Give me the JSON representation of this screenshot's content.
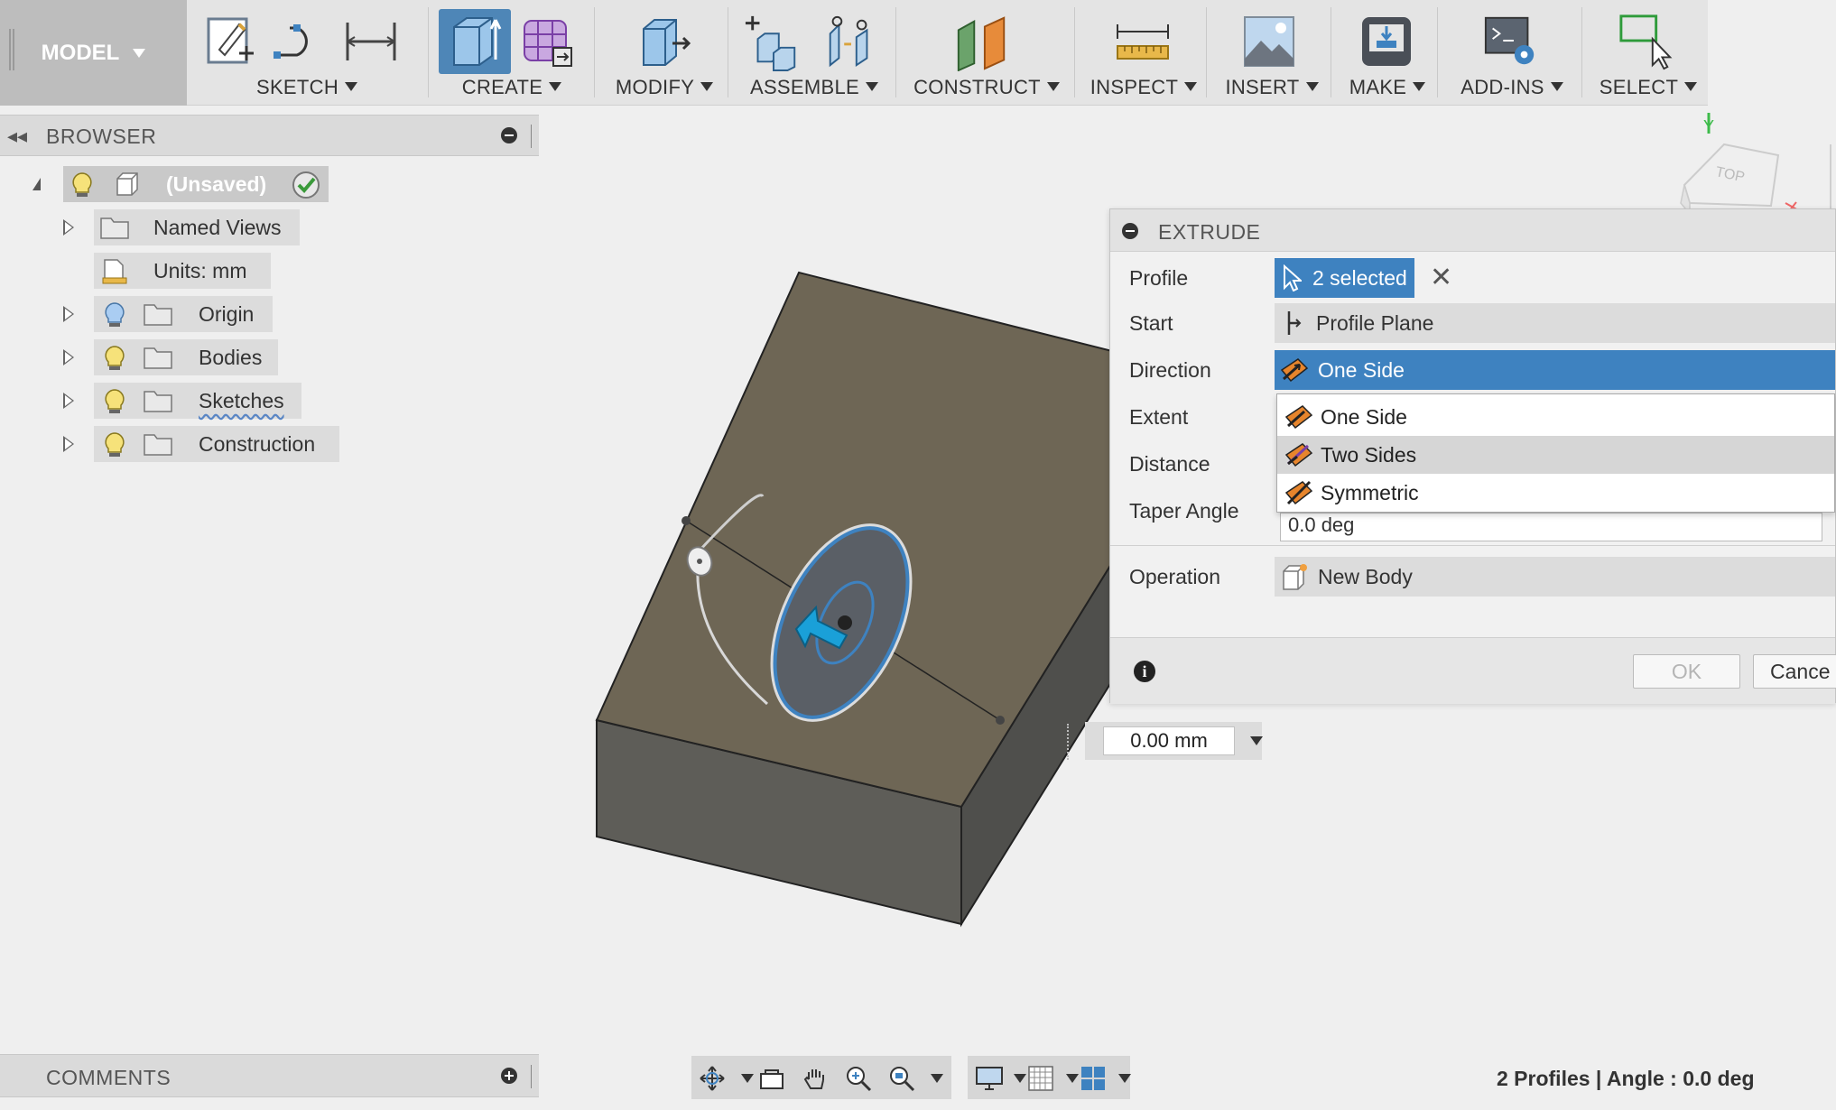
{
  "toolbar": {
    "workspace": "MODEL",
    "groups": [
      {
        "label": "SKETCH"
      },
      {
        "label": "CREATE"
      },
      {
        "label": "MODIFY"
      },
      {
        "label": "ASSEMBLE"
      },
      {
        "label": "CONSTRUCT"
      },
      {
        "label": "INSPECT"
      },
      {
        "label": "INSERT"
      },
      {
        "label": "MAKE"
      },
      {
        "label": "ADD-INS"
      },
      {
        "label": "SELECT"
      }
    ]
  },
  "browser": {
    "title": "BROWSER",
    "root": {
      "label": "(Unsaved)"
    },
    "items": [
      {
        "label": "Named Views"
      },
      {
        "label": "Units: mm"
      },
      {
        "label": "Origin"
      },
      {
        "label": "Bodies"
      },
      {
        "label": "Sketches"
      },
      {
        "label": "Construction"
      }
    ]
  },
  "comments": {
    "title": "COMMENTS"
  },
  "viewcube": {
    "face_label": "TOP",
    "axis_y": "Y"
  },
  "extrude": {
    "title": "EXTRUDE",
    "profile": {
      "label": "Profile",
      "value": "2 selected"
    },
    "start": {
      "label": "Start",
      "value": "Profile Plane"
    },
    "direction": {
      "label": "Direction",
      "value": "One Side",
      "options": [
        "One Side",
        "Two Sides",
        "Symmetric"
      ]
    },
    "extent": {
      "label": "Extent"
    },
    "distance": {
      "label": "Distance"
    },
    "taper_angle": {
      "label": "Taper Angle",
      "value": "0.0 deg"
    },
    "operation": {
      "label": "Operation",
      "value": "New Body"
    },
    "ok_label": "OK",
    "cancel_label": "Cance"
  },
  "distance_input": {
    "value": "0.00 mm"
  },
  "status": {
    "text": "2 Profiles | Angle : 0.0 deg"
  },
  "colors": {
    "accent": "#3e82c0",
    "body_top": "#6e6655",
    "body_front": "#5e5d58",
    "body_side": "#4f4f4c"
  }
}
